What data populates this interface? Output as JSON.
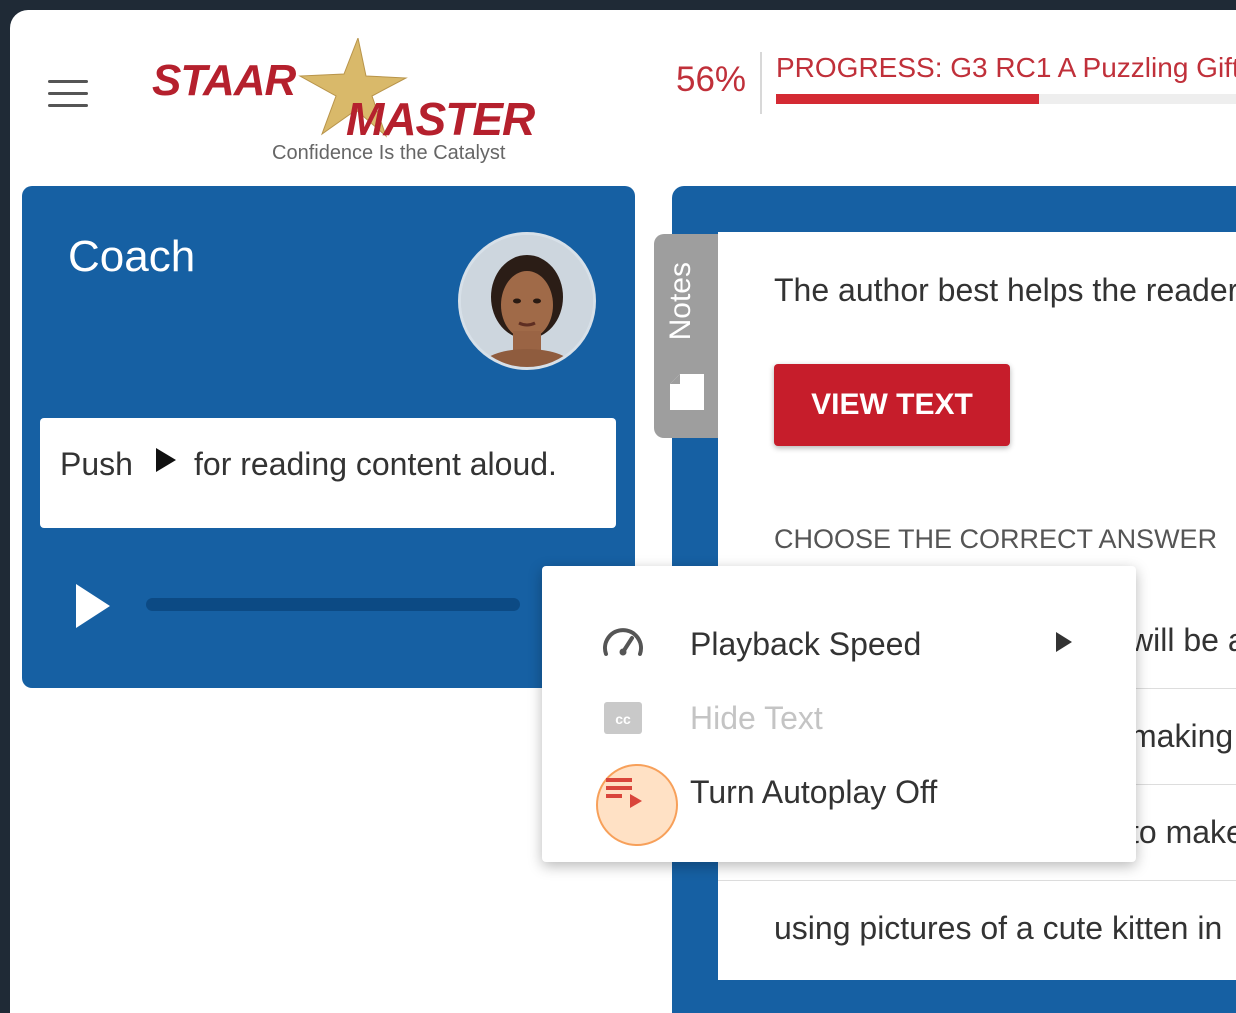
{
  "header": {
    "menu_icon": "hamburger-menu-icon",
    "logo": {
      "word1": "STAAR",
      "word2": "MASTER",
      "tagline": "Confidence Is the Catalyst"
    },
    "progress": {
      "percent_label": "56%",
      "percent_value": 0.56,
      "label": "PROGRESS: G3 RC1 A Puzzling Gift"
    }
  },
  "coach": {
    "title": "Coach",
    "message": {
      "before": "Push",
      "icon": "play-triangle-icon",
      "after": "for reading content aloud."
    },
    "player": {
      "play_icon": "play-icon"
    }
  },
  "notes_tab": {
    "label": "Notes",
    "icon": "note-icon"
  },
  "question": {
    "text": "The author best helps the reader",
    "view_text_button": "VIEW TEXT",
    "choose_label": "CHOOSE THE CORRECT ANSWER",
    "answers": [
      "will be a",
      "making",
      "to make",
      "using pictures of a cute kitten in"
    ]
  },
  "context_menu": {
    "items": [
      {
        "label": "Playback Speed",
        "icon": "speedometer-icon",
        "has_submenu": true,
        "disabled": false
      },
      {
        "label": "Hide Text",
        "icon": "closed-caption-icon",
        "has_submenu": false,
        "disabled": true
      },
      {
        "label": "Turn Autoplay Off",
        "icon": "playlist-play-icon",
        "has_submenu": false,
        "disabled": false
      }
    ]
  },
  "colors": {
    "brand_red": "#c61d2b",
    "panel_blue": "#1660a3",
    "progress_red": "#d42a33"
  }
}
